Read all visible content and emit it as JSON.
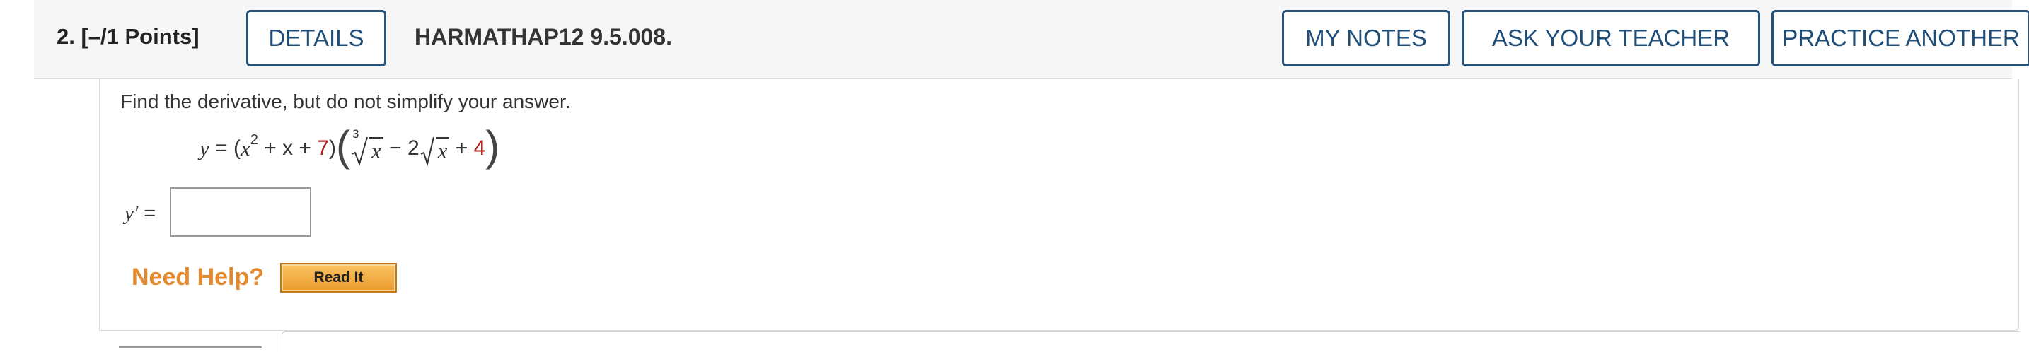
{
  "header": {
    "question_label": "2.  [–/1 Points]",
    "details_label": "DETAILS",
    "question_id": "HARMATHAP12 9.5.008.",
    "my_notes_label": "MY NOTES",
    "ask_teacher_label": "ASK YOUR TEACHER",
    "practice_another_label": "PRACTICE ANOTHER",
    "button_color": "#23527c"
  },
  "question": {
    "prompt": "Find the derivative, but do not simplify your answer.",
    "equation": {
      "lhs": "y",
      "equals": "=",
      "part1_open": "(",
      "x": "x",
      "exp2": "2",
      "plus_x": "+ x +",
      "const7": "7",
      "part1_close": ")",
      "cube_root_index": "3",
      "minus": "−",
      "coef2": "2",
      "plus": "+",
      "const4": "4"
    },
    "answer_label_var": "y′",
    "answer_label_eq": "=",
    "answer_value": ""
  },
  "help": {
    "need_help_label": "Need Help?",
    "read_it_label": "Read It",
    "accent_color": "#e5892f"
  }
}
